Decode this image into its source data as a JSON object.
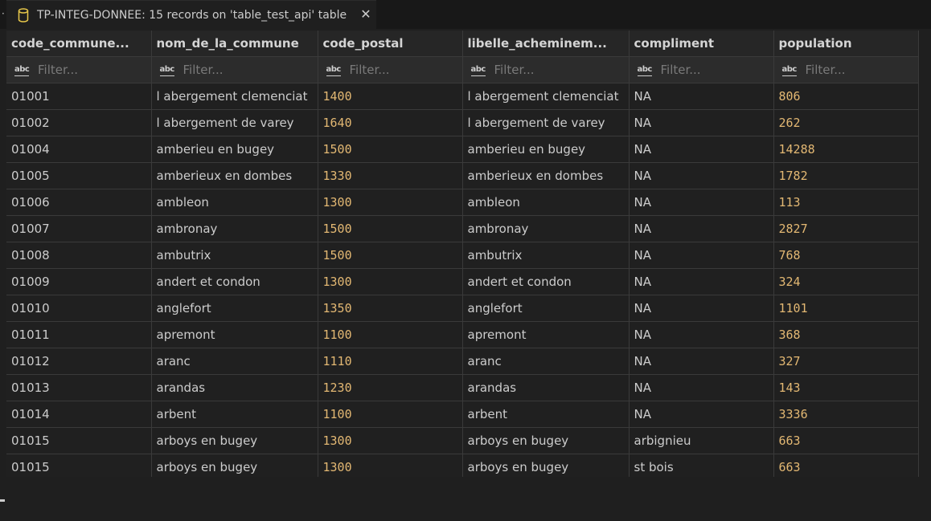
{
  "tab": {
    "title": "TP-INTEG-DONNEE: 15 records on 'table_test_api' table",
    "close_glyph": "✕",
    "icon": "database-icon"
  },
  "table": {
    "columns": [
      "code_commune...",
      "nom_de_la_commune",
      "code_postal",
      "libelle_acheminem...",
      "compliment",
      "population"
    ],
    "filter_placeholder": "Filter...",
    "filter_type_icon": "abc",
    "rows": [
      [
        "01001",
        "l abergement clemenciat",
        "1400",
        "l abergement clemenciat",
        "NA",
        "806"
      ],
      [
        "01002",
        "l abergement de varey",
        "1640",
        "l abergement de varey",
        "NA",
        "262"
      ],
      [
        "01004",
        "amberieu en bugey",
        "1500",
        "amberieu en bugey",
        "NA",
        "14288"
      ],
      [
        "01005",
        "amberieux en dombes",
        "1330",
        "amberieux en dombes",
        "NA",
        "1782"
      ],
      [
        "01006",
        "ambleon",
        "1300",
        "ambleon",
        "NA",
        "113"
      ],
      [
        "01007",
        "ambronay",
        "1500",
        "ambronay",
        "NA",
        "2827"
      ],
      [
        "01008",
        "ambutrix",
        "1500",
        "ambutrix",
        "NA",
        "768"
      ],
      [
        "01009",
        "andert et condon",
        "1300",
        "andert et condon",
        "NA",
        "324"
      ],
      [
        "01010",
        "anglefort",
        "1350",
        "anglefort",
        "NA",
        "1101"
      ],
      [
        "01011",
        "apremont",
        "1100",
        "apremont",
        "NA",
        "368"
      ],
      [
        "01012",
        "aranc",
        "1110",
        "aranc",
        "NA",
        "327"
      ],
      [
        "01013",
        "arandas",
        "1230",
        "arandas",
        "NA",
        "143"
      ],
      [
        "01014",
        "arbent",
        "1100",
        "arbent",
        "NA",
        "3336"
      ],
      [
        "01015",
        "arboys en bugey",
        "1300",
        "arboys en bugey",
        "arbignieu",
        "663"
      ],
      [
        "01015",
        "arboys en bugey",
        "1300",
        "arboys en bugey",
        "st bois",
        "663"
      ]
    ],
    "numeric_columns": [
      2,
      5
    ]
  },
  "colors": {
    "background": "#1f1f1f",
    "numeric_text": "#e3b873",
    "text": "#cccccc",
    "tab_icon": "#e8c84a"
  }
}
